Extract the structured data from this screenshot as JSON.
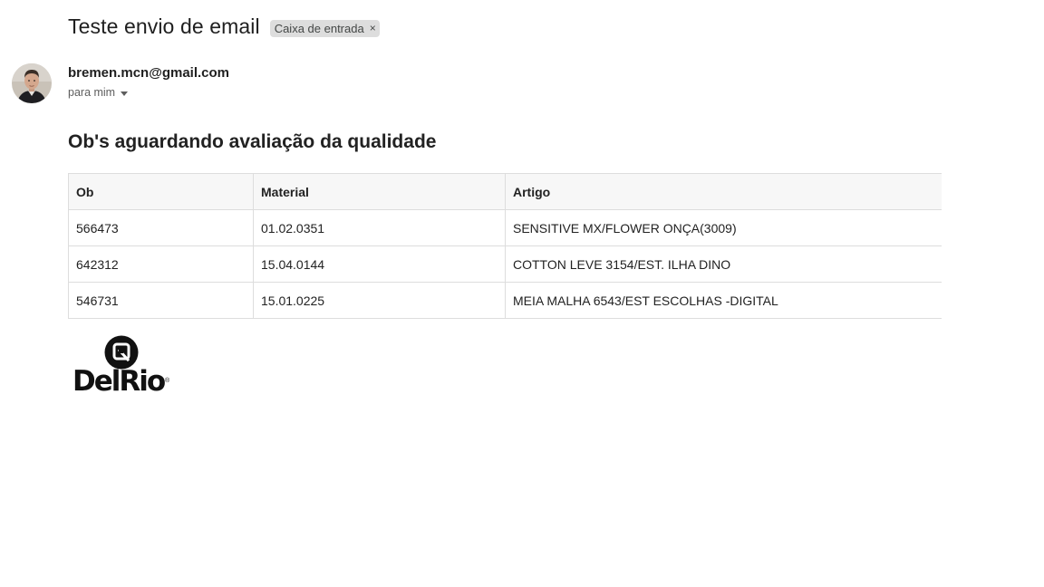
{
  "email": {
    "subject": "Teste envio de email",
    "label_chip": "Caixa de entrada",
    "label_remove": "×",
    "sender": "bremen.mcn@gmail.com",
    "recipient": "para mim"
  },
  "body": {
    "heading": "Ob's aguardando avaliação da qualidade",
    "table": {
      "headers": [
        "Ob",
        "Material",
        "Artigo"
      ],
      "rows": [
        [
          "566473",
          "01.02.0351",
          "SENSITIVE MX/FLOWER ONÇA(3009)"
        ],
        [
          "642312",
          "15.04.0144",
          "COTTON LEVE 3154/EST. ILHA DINO"
        ],
        [
          "546731",
          "15.01.0225",
          "MEIA MALHA 6543/EST ESCOLHAS -DIGITAL"
        ]
      ]
    },
    "logo": {
      "text": "DelRio",
      "registered": "®",
      "icon": "delrio-logo-mark"
    }
  },
  "colors": {
    "chip_bg": "#dddddd",
    "table_border": "#dddddd",
    "header_bg": "#f7f7f7",
    "text": "#1f1f1f"
  }
}
